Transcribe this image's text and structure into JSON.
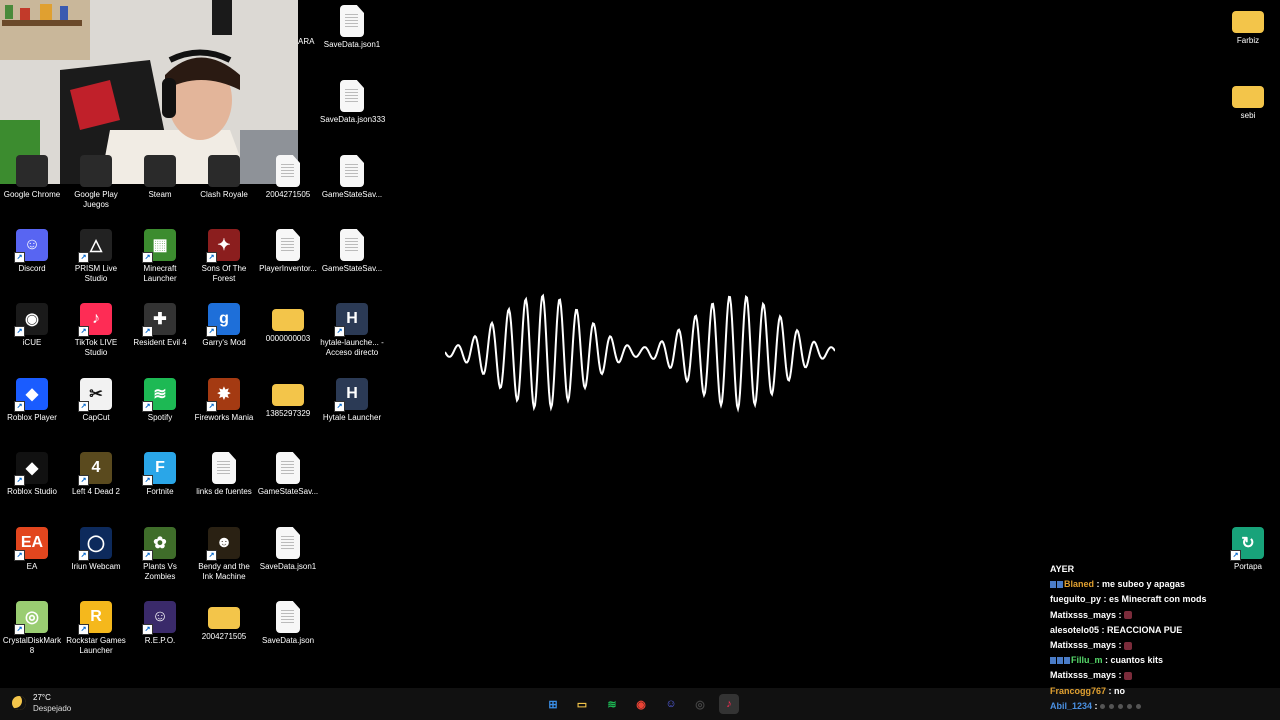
{
  "desktop": {
    "icons": [
      {
        "name": "google-chrome-icon",
        "label": "Google Chrome",
        "type": "app",
        "color": "#2a2a2a",
        "glyph": ""
      },
      {
        "name": "google-play-games-icon",
        "label": "Google Play Juegos",
        "type": "app",
        "color": "#2a2a2a",
        "glyph": ""
      },
      {
        "name": "steam-icon",
        "label": "Steam",
        "type": "app",
        "color": "#2a2a2a",
        "glyph": ""
      },
      {
        "name": "clash-royale-icon",
        "label": "Clash Royale",
        "type": "app",
        "color": "#2a2a2a",
        "glyph": ""
      },
      {
        "name": "file-2004271505-icon",
        "label": "2004271505",
        "type": "file"
      },
      {
        "name": "gamestatesave-file-1",
        "label": "GameStateSav...",
        "type": "file"
      },
      {
        "name": "discord-icon",
        "label": "Discord",
        "type": "app",
        "color": "#5865F2",
        "glyph": "☺"
      },
      {
        "name": "prism-live-studio-icon",
        "label": "PRISM Live Studio",
        "type": "app",
        "color": "#222",
        "glyph": "△"
      },
      {
        "name": "minecraft-launcher-icon",
        "label": "Minecraft Launcher",
        "type": "app",
        "color": "#3c8c2f",
        "glyph": "▦"
      },
      {
        "name": "sons-of-the-forest-icon",
        "label": "Sons Of The Forest",
        "type": "app",
        "color": "#8b1e1e",
        "glyph": "✦"
      },
      {
        "name": "playerinventory-file",
        "label": "PlayerInventor...",
        "type": "file"
      },
      {
        "name": "gamestatesave-file-2",
        "label": "GameStateSav...",
        "type": "file"
      },
      {
        "name": "icue-icon",
        "label": "iCUE",
        "type": "app",
        "color": "#1a1a1a",
        "glyph": "◉"
      },
      {
        "name": "tiktok-live-studio-icon",
        "label": "TikTok LIVE Studio",
        "type": "app",
        "color": "#fe2c55",
        "glyph": "♪"
      },
      {
        "name": "resident-evil-4-icon",
        "label": "Resident Evil 4",
        "type": "app",
        "color": "#333",
        "glyph": "✚"
      },
      {
        "name": "garrys-mod-icon",
        "label": "Garry's Mod",
        "type": "app",
        "color": "#1e6fd9",
        "glyph": "g"
      },
      {
        "name": "folder-0000000003-icon",
        "label": "0000000003",
        "type": "folder"
      },
      {
        "name": "hytale-launcher-shortcut-icon",
        "label": "hytale-launche... - Acceso directo",
        "type": "app",
        "color": "#2b3a55",
        "glyph": "H"
      },
      {
        "name": "roblox-player-icon",
        "label": "Roblox Player",
        "type": "app",
        "color": "#1a5cff",
        "glyph": "◆"
      },
      {
        "name": "capcut-icon",
        "label": "CapCut",
        "type": "app",
        "color": "#f2f2f2",
        "glyph": "✂"
      },
      {
        "name": "spotify-icon",
        "label": "Spotify",
        "type": "app",
        "color": "#1DB954",
        "glyph": "≋"
      },
      {
        "name": "fireworks-mania-icon",
        "label": "Fireworks Mania",
        "type": "app",
        "color": "#a43a12",
        "glyph": "✸"
      },
      {
        "name": "folder-1385297329-icon",
        "label": "1385297329",
        "type": "folder"
      },
      {
        "name": "hytale-launcher-icon",
        "label": "Hytale Launcher",
        "type": "app",
        "color": "#2b3a55",
        "glyph": "H"
      },
      {
        "name": "roblox-studio-icon",
        "label": "Roblox Studio",
        "type": "app",
        "color": "#111",
        "glyph": "◆"
      },
      {
        "name": "left-4-dead-2-icon",
        "label": "Left 4 Dead 2",
        "type": "app",
        "color": "#5a4a1e",
        "glyph": "4"
      },
      {
        "name": "fortnite-icon",
        "label": "Fortnite",
        "type": "app",
        "color": "#2aa6e8",
        "glyph": "F"
      },
      {
        "name": "links-de-fuentes-file",
        "label": "links de fuentes",
        "type": "file"
      },
      {
        "name": "gamestatesave-file-3",
        "label": "GameStateSav...",
        "type": "file"
      },
      {
        "name": "ea-icon",
        "label": "EA",
        "type": "app",
        "color": "#e2461e",
        "glyph": "EA"
      },
      {
        "name": "iriun-webcam-icon",
        "label": "Iriun Webcam",
        "type": "app",
        "color": "#0d2a5c",
        "glyph": "◯"
      },
      {
        "name": "plants-vs-zombies-icon",
        "label": "Plants Vs Zombies",
        "type": "app",
        "color": "#3f6d2a",
        "glyph": "✿"
      },
      {
        "name": "bendy-ink-machine-icon",
        "label": "Bendy and the Ink Machine",
        "type": "app",
        "color": "#2a2113",
        "glyph": "☻"
      },
      {
        "name": "savedata-json1-file-2",
        "label": "SaveData.json1",
        "type": "file"
      },
      {
        "name": "crystaldiskmark-icon",
        "label": "CrystalDiskMark 8",
        "type": "app",
        "color": "#9acd72",
        "glyph": "◎"
      },
      {
        "name": "rockstar-games-launcher-icon",
        "label": "Rockstar Games Launcher",
        "type": "app",
        "color": "#f5b81c",
        "glyph": "R"
      },
      {
        "name": "repo-icon",
        "label": "R.E.P.O.",
        "type": "app",
        "color": "#3a2a6a",
        "glyph": "☺"
      },
      {
        "name": "folder-2004271505-icon",
        "label": "2004271505",
        "type": "folder"
      },
      {
        "name": "savedata-json-file",
        "label": "SaveData.json",
        "type": "file"
      },
      {
        "name": "savedata-json1-file",
        "label": "SaveData.json1",
        "type": "file"
      },
      {
        "name": "savedata-json333-file",
        "label": "SaveData.json333",
        "type": "file"
      },
      {
        "name": "farbiz-folder-icon",
        "label": "Farbiz",
        "type": "folder"
      },
      {
        "name": "sebi-folder-icon",
        "label": "sebi",
        "type": "folder"
      },
      {
        "name": "pasteboard-app-icon",
        "label": "Portapa",
        "type": "app",
        "color": "#18a37a",
        "glyph": "↻"
      }
    ],
    "partial_label": "ARA"
  },
  "taskbar": {
    "weather": {
      "temp": "27°C",
      "condition": "Despejado"
    },
    "icons": [
      {
        "name": "start-icon",
        "glyph": "⊞",
        "color": "#3a8ee6"
      },
      {
        "name": "file-explorer-icon",
        "glyph": "▭",
        "color": "#f3c54a"
      },
      {
        "name": "spotify-taskbar-icon",
        "glyph": "≋",
        "color": "#1DB954"
      },
      {
        "name": "chrome-taskbar-icon",
        "glyph": "◉",
        "color": "#ea4335"
      },
      {
        "name": "discord-taskbar-icon",
        "glyph": "☺",
        "color": "#5865F2"
      },
      {
        "name": "obs-taskbar-icon",
        "glyph": "◎",
        "color": "#444"
      },
      {
        "name": "tiktok-taskbar-icon",
        "glyph": "♪",
        "color": "#fe2c55"
      }
    ]
  },
  "chat": {
    "header": "AYER",
    "messages": [
      {
        "user": "Blaned",
        "text": "me subeo y apagas",
        "color": "#e0a030",
        "badges": 2
      },
      {
        "user": "fueguito_py",
        "text": "es Minecraft con mods",
        "color": "#ffffff",
        "badges": 0
      },
      {
        "user": "Matixsss_mays",
        "text": "",
        "color": "#ffffff",
        "badges": 0,
        "emote": true
      },
      {
        "user": "alesotelo05",
        "text": "REACCIONA PUE",
        "color": "#ffffff",
        "badges": 0
      },
      {
        "user": "Matixsss_mays",
        "text": "",
        "color": "#ffffff",
        "badges": 0,
        "emote": true
      },
      {
        "user": "Fillu_m",
        "text": "cuantos kits",
        "color": "#56d86a",
        "badges": 3
      },
      {
        "user": "Matixsss_mays",
        "text": "",
        "color": "#ffffff",
        "badges": 0,
        "emote": true
      },
      {
        "user": "Francogg767",
        "text": "no",
        "color": "#e0a030",
        "badges": 0
      },
      {
        "user": "Abil_1234",
        "text": "",
        "color": "#4a90e2",
        "badges": 0,
        "dots": true
      }
    ]
  }
}
